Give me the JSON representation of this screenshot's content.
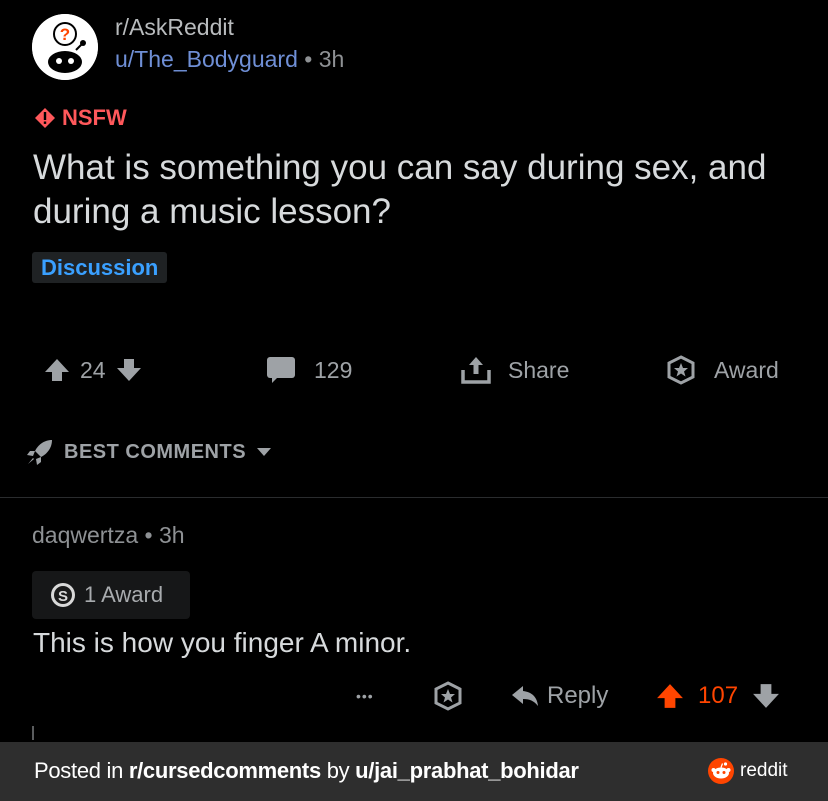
{
  "post": {
    "subreddit": "r/AskReddit",
    "author": "u/The_Bodyguard",
    "separator": "•",
    "age": "3h",
    "nsfw_label": "NSFW",
    "title": "What is something you can say during sex, and during a music lesson?",
    "flair": "Discussion"
  },
  "actions": {
    "score": "24",
    "comments": "129",
    "share": "Share",
    "award": "Award"
  },
  "sort": {
    "label": "BEST COMMENTS"
  },
  "comment": {
    "author": "daqwertza",
    "separator": "•",
    "age": "3h",
    "award_count": "1 Award",
    "body": "This is how you finger A minor.",
    "more": "•••",
    "reply": "Reply",
    "score": "107"
  },
  "footer": {
    "prefix": "Posted in ",
    "subreddit": "r/cursedcomments",
    "mid": " by ",
    "user": "u/jai_prabhat_bohidar",
    "brand": "reddit"
  },
  "colors": {
    "background": "#000000",
    "nsfw": "#ff585b",
    "flair_text": "#3aa0ff",
    "upvote_active": "#ff4500",
    "footer_bg": "#2e2e2e"
  },
  "icons": [
    "askreddit-avatar-icon",
    "nsfw-diamond-icon",
    "upvote-icon",
    "downvote-icon",
    "comment-icon",
    "share-icon",
    "award-icon",
    "rocket-icon",
    "chevron-down-icon",
    "silver-award-icon",
    "more-icon",
    "reply-icon",
    "reddit-logo-icon"
  ]
}
